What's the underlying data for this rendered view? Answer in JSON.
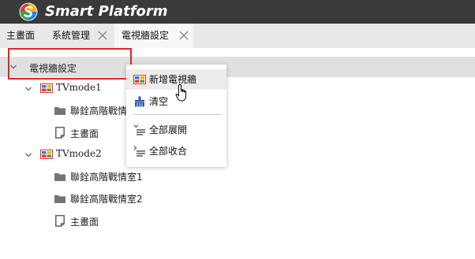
{
  "app": {
    "title": "Smart Platform"
  },
  "tabs": [
    {
      "label": "主畫面",
      "closable": false
    },
    {
      "label": "系統管理",
      "closable": true
    },
    {
      "label": "電視牆設定",
      "closable": true,
      "active": true
    }
  ],
  "tree": {
    "root_label": "電視牆設定",
    "nodes": [
      {
        "label": "TVmode1",
        "children": [
          "聯銓高階戰情",
          "主畫面"
        ]
      },
      {
        "label": "TVmode2",
        "children": [
          "聯銓高階戰情室1",
          "聯銓高階戰情室2",
          "主畫面"
        ]
      }
    ]
  },
  "context_menu": {
    "items": [
      {
        "label": "新增電視牆",
        "icon": "tv-wall-icon",
        "hover": true
      },
      {
        "label": "清空",
        "icon": "broom-icon"
      },
      {
        "label": "全部展開",
        "icon": "expand-all-icon"
      },
      {
        "label": "全部收合",
        "icon": "collapse-all-icon"
      }
    ]
  },
  "colors": {
    "titlebar": "#3a3a3a",
    "tabbar": "#e9e9e9",
    "highlight": "#e02424",
    "folder": "#757575"
  }
}
